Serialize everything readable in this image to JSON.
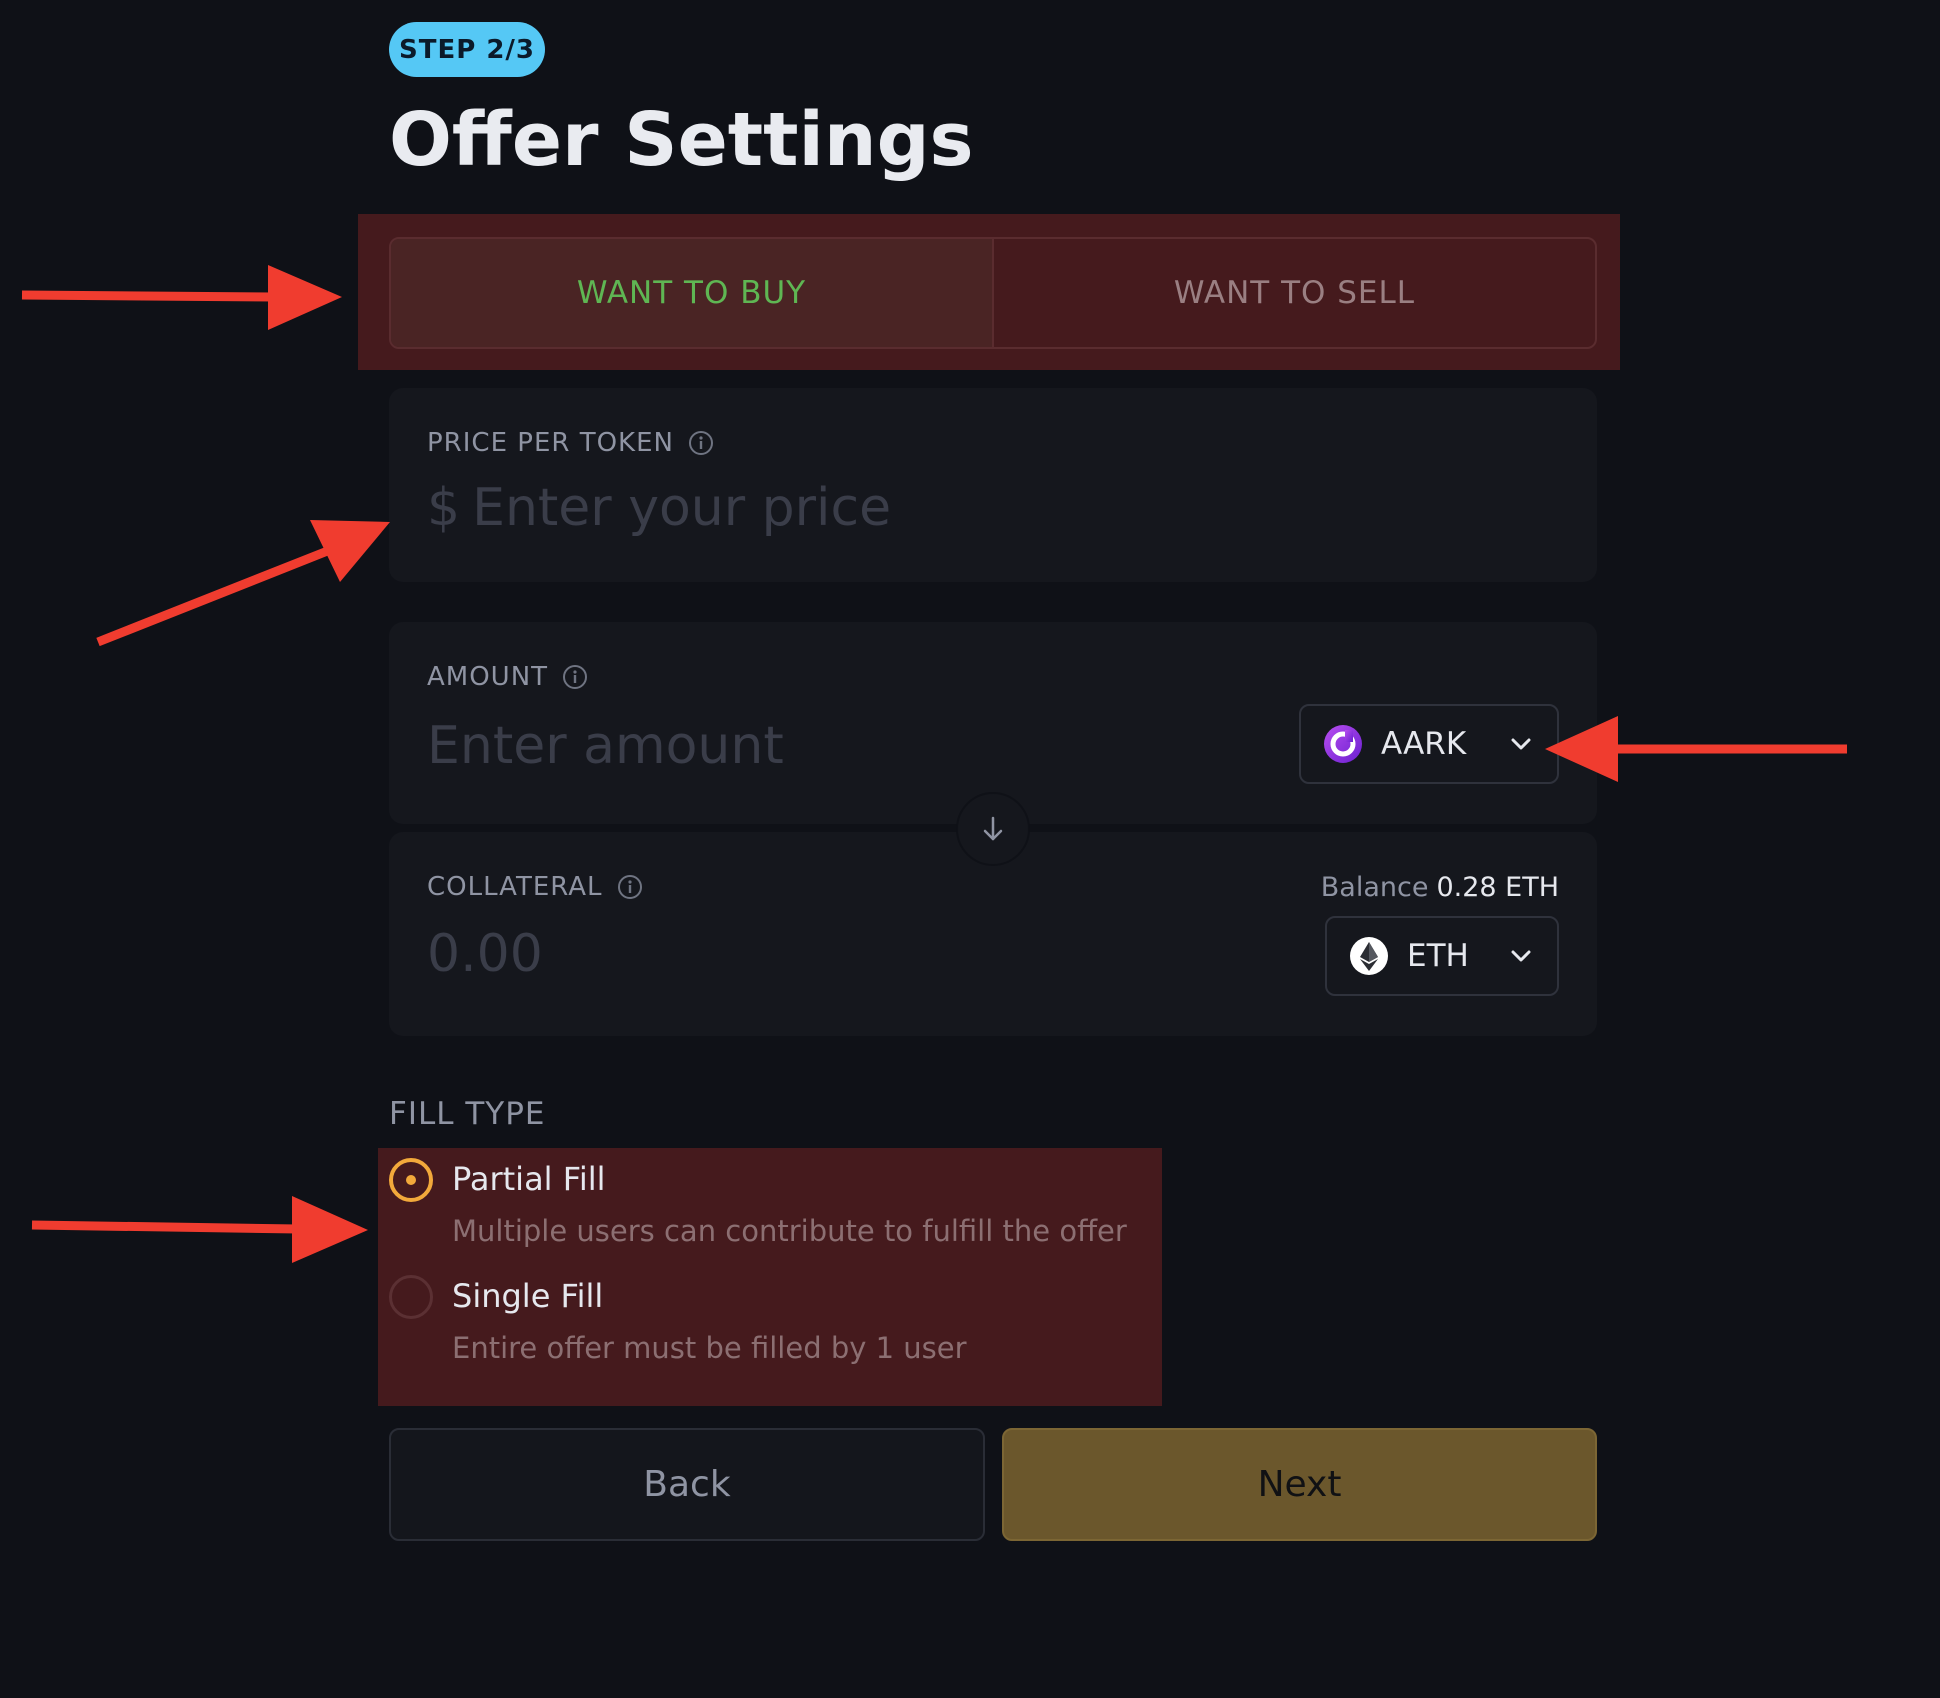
{
  "step_badge": "STEP 2/3",
  "title": "Offer Settings",
  "trade_toggle": {
    "buy_label": "WANT TO BUY",
    "sell_label": "WANT TO SELL",
    "selected": "buy"
  },
  "price": {
    "label": "PRICE PER TOKEN",
    "currency_symbol": "$",
    "placeholder": "Enter your price",
    "value": ""
  },
  "amount": {
    "label": "AMOUNT",
    "placeholder": "Enter amount",
    "value": "",
    "token": "AARK",
    "token_icon": "aark-logo-icon"
  },
  "collateral": {
    "label": "COLLATERAL",
    "value": "0.00",
    "balance_label": "Balance",
    "balance_value": "0.28 ETH",
    "token": "ETH",
    "token_icon": "eth-logo-icon"
  },
  "fill_type": {
    "label": "FILL TYPE",
    "options": [
      {
        "title": "Partial Fill",
        "description": "Multiple users can contribute to fulfill the offer",
        "selected": true
      },
      {
        "title": "Single Fill",
        "description": "Entire offer must be filled by 1 user",
        "selected": false
      }
    ]
  },
  "buttons": {
    "back": "Back",
    "next": "Next"
  },
  "colors": {
    "background": "#0f1117",
    "badge": "#55c8f5",
    "buy_text": "#5fb653",
    "radio_accent": "#f2a93b",
    "next_button": "#6b572c",
    "highlight": "#451a1d",
    "annotation_arrow": "#f03c2f"
  }
}
